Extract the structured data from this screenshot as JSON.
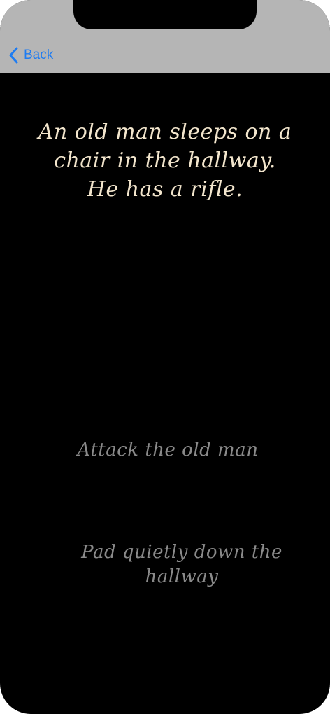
{
  "nav": {
    "back_label": "Back",
    "back_icon": "chevron-left-icon",
    "accent_color": "#1e7cf2",
    "bar_color": "#b5b5b5"
  },
  "story": {
    "text": "An old man sleeps on a chair in the hallway. He has a rifle.",
    "color": "#f3e6cd"
  },
  "choices": [
    {
      "label": "Attack the old man",
      "color": "#8a8a8a"
    },
    {
      "label": "Pad quietly down the hallway",
      "color": "#8a8a8a"
    }
  ],
  "theme": {
    "background": "#000000"
  }
}
